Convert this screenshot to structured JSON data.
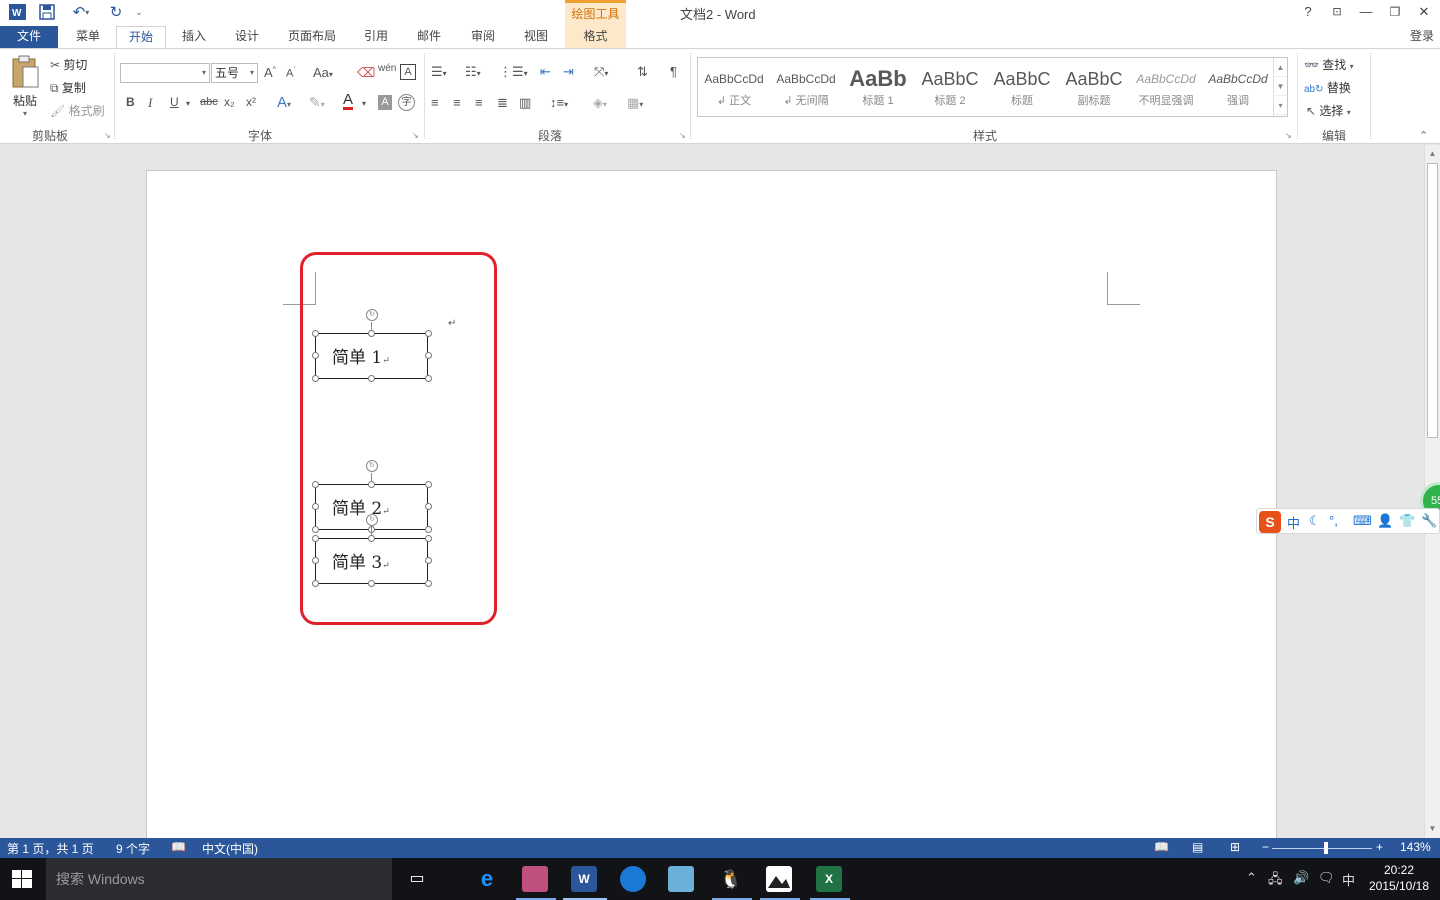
{
  "window": {
    "title": "文档2 - Word",
    "contextual_tab_group": "绘图工具",
    "help": "?",
    "ribbon_display": "⊡",
    "minimize": "—",
    "restore": "❐",
    "close": "✕",
    "sign_in": "登录"
  },
  "tabs": [
    {
      "label": "文件"
    },
    {
      "label": "菜单"
    },
    {
      "label": "开始"
    },
    {
      "label": "插入"
    },
    {
      "label": "设计"
    },
    {
      "label": "页面布局"
    },
    {
      "label": "引用"
    },
    {
      "label": "邮件"
    },
    {
      "label": "审阅"
    },
    {
      "label": "视图"
    },
    {
      "label": "格式"
    }
  ],
  "ribbon": {
    "clipboard": {
      "group": "剪贴板",
      "paste": "粘贴",
      "cut": "剪切",
      "copy": "复制",
      "format_painter": "格式刷"
    },
    "font": {
      "group": "字体",
      "font_name": "",
      "font_size": "五号",
      "bold": "B",
      "italic": "I",
      "underline": "U",
      "strike": "abc",
      "subscript": "x₂",
      "superscript": "x²",
      "change_case": "Aa",
      "grow": "A",
      "shrink": "A"
    },
    "paragraph": {
      "group": "段落"
    },
    "styles": {
      "group": "样式",
      "items": [
        {
          "sample": "AaBbCcDd",
          "name": "↲ 正文"
        },
        {
          "sample": "AaBbCcDd",
          "name": "↲ 无间隔"
        },
        {
          "sample": "AaBb",
          "name": "标题 1"
        },
        {
          "sample": "AaBbC",
          "name": "标题 2"
        },
        {
          "sample": "AaBbC",
          "name": "标题"
        },
        {
          "sample": "AaBbC",
          "name": "副标题"
        },
        {
          "sample": "AaBbCcDd",
          "name": "不明显强调"
        },
        {
          "sample": "AaBbCcDd",
          "name": "强调"
        }
      ]
    },
    "editing": {
      "group": "编辑",
      "find": "查找",
      "replace": "替换",
      "select": "选择"
    }
  },
  "document": {
    "shapes": [
      {
        "text": "简单 1"
      },
      {
        "text": "简单 2"
      },
      {
        "text": "简单 3"
      }
    ],
    "paragraph_mark": "↵"
  },
  "ime": {
    "logo": "S",
    "mode": "中",
    "badge": "55"
  },
  "statusbar": {
    "page": "第 1 页，共 1 页",
    "words": "9 个字",
    "language": "中文(中国)",
    "zoom": "143%"
  },
  "taskbar": {
    "search_placeholder": "搜索 Windows",
    "time": "20:22",
    "date": "2015/10/18",
    "ime_indicator": "中"
  }
}
